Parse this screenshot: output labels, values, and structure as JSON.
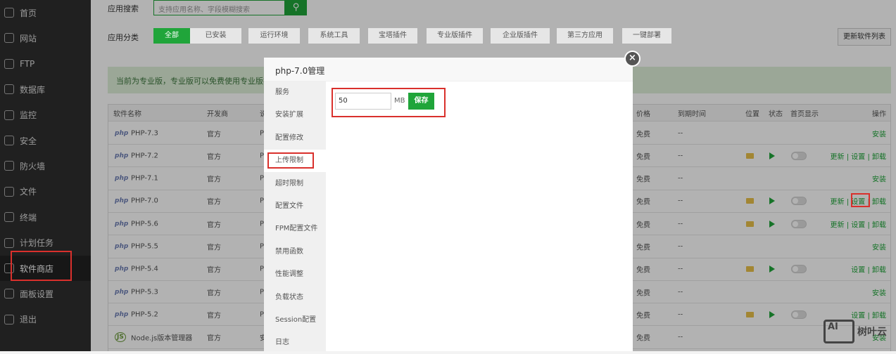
{
  "sidebar": {
    "items": [
      "首页",
      "网站",
      "FTP",
      "数据库",
      "监控",
      "安全",
      "防火墙",
      "文件",
      "终端",
      "计划任务",
      "软件商店",
      "面板设置",
      "退出"
    ],
    "active": 10
  },
  "search": {
    "label": "应用搜索",
    "placeholder": "支持应用名称、字段模糊搜索"
  },
  "categories": {
    "label": "应用分类",
    "items": [
      "全部",
      "已安装",
      "运行环境",
      "系统工具",
      "宝塔插件",
      "专业版插件",
      "企业版插件",
      "第三方应用",
      "一键部署"
    ],
    "update_button": "更新软件列表"
  },
  "banner": "当前为专业版，专业版可以免费使用专业版插件",
  "table": {
    "headers": {
      "name": "软件名称",
      "dev": "开发商",
      "desc": "说",
      "price": "价格",
      "expire": "到期时间",
      "pos": "位置",
      "state": "状态",
      "home": "首页显示",
      "ops": "操作"
    },
    "rows": [
      {
        "icon": "php",
        "name": "PHP-7.3",
        "dev": "官方",
        "desc": "P",
        "price": "免费",
        "expire": "--",
        "installed": false,
        "ops": "安装"
      },
      {
        "icon": "php",
        "name": "PHP-7.2",
        "dev": "官方",
        "desc": "P",
        "price": "免费",
        "expire": "--",
        "installed": true,
        "ops": "更新 | 设置 | 卸载"
      },
      {
        "icon": "php",
        "name": "PHP-7.1",
        "dev": "官方",
        "desc": "P",
        "price": "免费",
        "expire": "--",
        "installed": false,
        "ops": "安装"
      },
      {
        "icon": "php",
        "name": "PHP-7.0",
        "dev": "官方",
        "desc": "P",
        "price": "免费",
        "expire": "--",
        "installed": true,
        "ops": "更新 | 设置 | 卸载"
      },
      {
        "icon": "php",
        "name": "PHP-5.6",
        "dev": "官方",
        "desc": "P",
        "price": "免费",
        "expire": "--",
        "installed": true,
        "ops": "更新 | 设置 | 卸载"
      },
      {
        "icon": "php",
        "name": "PHP-5.5",
        "dev": "官方",
        "desc": "P",
        "price": "免费",
        "expire": "--",
        "installed": false,
        "ops": "安装"
      },
      {
        "icon": "php",
        "name": "PHP-5.4",
        "dev": "官方",
        "desc": "P",
        "price": "免费",
        "expire": "--",
        "installed": true,
        "ops": "设置 | 卸载"
      },
      {
        "icon": "php",
        "name": "PHP-5.3",
        "dev": "官方",
        "desc": "P",
        "price": "免费",
        "expire": "--",
        "installed": false,
        "ops": "安装"
      },
      {
        "icon": "php",
        "name": "PHP-5.2",
        "dev": "官方",
        "desc": "P",
        "price": "免费",
        "expire": "--",
        "installed": true,
        "ops": "设置 | 卸载"
      },
      {
        "icon": "JS",
        "name": "Node.js版本管理器",
        "dev": "官方",
        "desc": "安",
        "price": "免费",
        "expire": "--",
        "installed": false,
        "ops": "安装"
      }
    ]
  },
  "modal": {
    "title": "php-7.0管理",
    "menu": [
      "服务",
      "安装扩展",
      "配置修改",
      "上传限制",
      "超时限制",
      "配置文件",
      "FPM配置文件",
      "禁用函数",
      "性能调整",
      "负载状态",
      "Session配置",
      "日志"
    ],
    "active": 3,
    "upload_value": "50",
    "unit": "MB",
    "save": "保存",
    "close": "×"
  },
  "watermark": {
    "logo": "AI",
    "text": "树叶云"
  },
  "colors": {
    "accent": "#20a53a",
    "highlight": "#d9302c"
  }
}
